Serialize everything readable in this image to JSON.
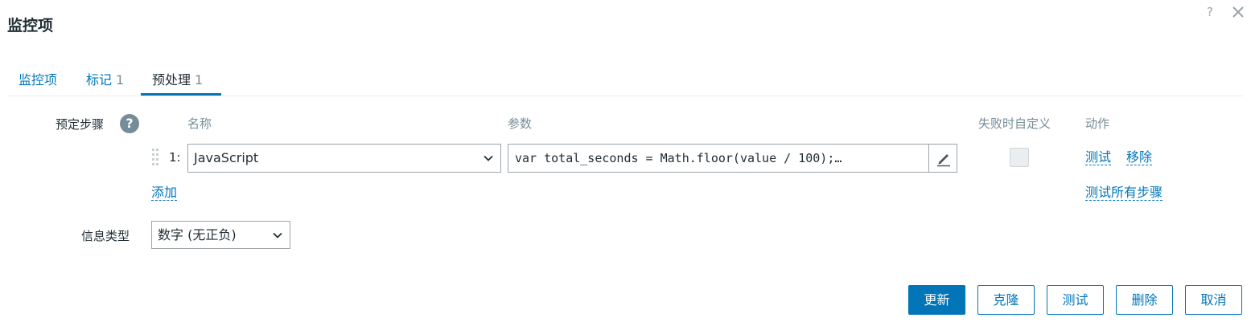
{
  "dialog": {
    "title": "监控项",
    "help_label": "?",
    "close_icon": "close-icon"
  },
  "tabs": [
    {
      "label": "监控项",
      "count": ""
    },
    {
      "label": "标记",
      "count": "1"
    },
    {
      "label": "预处理",
      "count": "1",
      "active": true
    }
  ],
  "preprocessing": {
    "label": "预定步骤",
    "help_badge": "?",
    "columns": {
      "name": "名称",
      "params": "参数",
      "custom_on_fail": "失败时自定义",
      "actions": "动作"
    },
    "steps": [
      {
        "index": "1:",
        "type": "JavaScript",
        "param": "var total_seconds = Math.floor(value / 100);…",
        "custom_on_fail": false,
        "actions": [
          "测试",
          "移除"
        ]
      }
    ],
    "add_link": "添加",
    "test_all_link": "测试所有步骤"
  },
  "info_type": {
    "label": "信息类型",
    "value": "数字 (无正负)"
  },
  "buttons": {
    "update": "更新",
    "clone": "克隆",
    "test": "测试",
    "delete": "删除",
    "cancel": "取消"
  },
  "colors": {
    "accent": "#0275b8",
    "muted": "#768d99",
    "border": "#9fa5a8",
    "text": "#1f2c33"
  }
}
